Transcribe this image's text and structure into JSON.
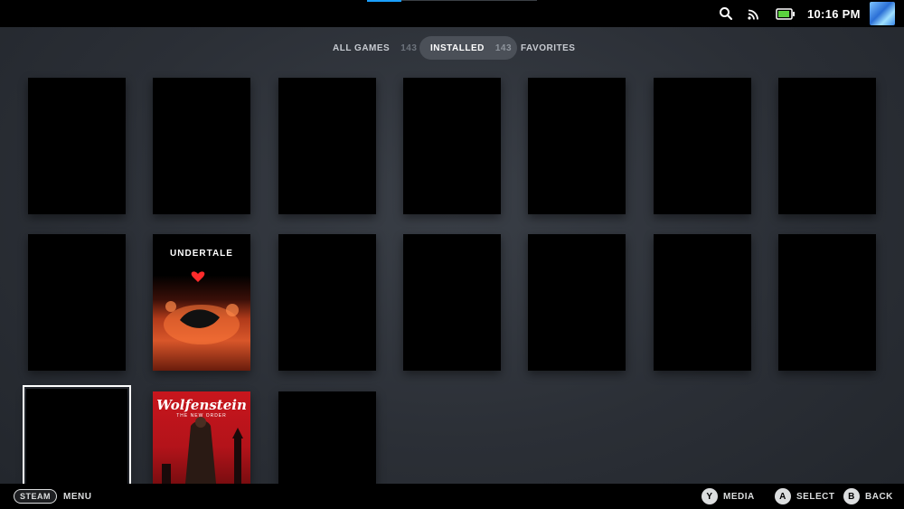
{
  "topbar": {
    "time": "10:16 PM",
    "icons": [
      "search-icon",
      "wifi-icon",
      "battery-icon",
      "avatar"
    ]
  },
  "tabs": [
    {
      "label": "ALL GAMES",
      "count": "143",
      "active": false
    },
    {
      "label": "INSTALLED",
      "count": "143",
      "active": true
    },
    {
      "label": "FAVORITES",
      "count": "",
      "active": false
    }
  ],
  "games": [
    {
      "title": "",
      "art": "blank"
    },
    {
      "title": "",
      "art": "blank"
    },
    {
      "title": "",
      "art": "blank"
    },
    {
      "title": "",
      "art": "blank"
    },
    {
      "title": "",
      "art": "blank"
    },
    {
      "title": "",
      "art": "blank"
    },
    {
      "title": "",
      "art": "blank"
    },
    {
      "title": "",
      "art": "blank"
    },
    {
      "title": "UNDERTALE",
      "art": "undertale"
    },
    {
      "title": "",
      "art": "blank"
    },
    {
      "title": "",
      "art": "blank"
    },
    {
      "title": "",
      "art": "blank"
    },
    {
      "title": "",
      "art": "blank"
    },
    {
      "title": "",
      "art": "blank"
    },
    {
      "title": "",
      "art": "blank",
      "focused": true
    },
    {
      "title": "Wolfenstein",
      "subtitle": "THE NEW ORDER",
      "art": "wolfenstein"
    },
    {
      "title": "",
      "art": "blank"
    }
  ],
  "bottombar": {
    "steam_label": "STEAM",
    "menu_label": "MENU",
    "y_button": "Y",
    "y_label": "MEDIA",
    "a_button": "A",
    "a_label": "SELECT",
    "b_button": "B",
    "b_label": "BACK"
  },
  "colors": {
    "accent": "#1a9fff",
    "active_tab_bg": "#4b5058",
    "background": "#2b2f36"
  }
}
